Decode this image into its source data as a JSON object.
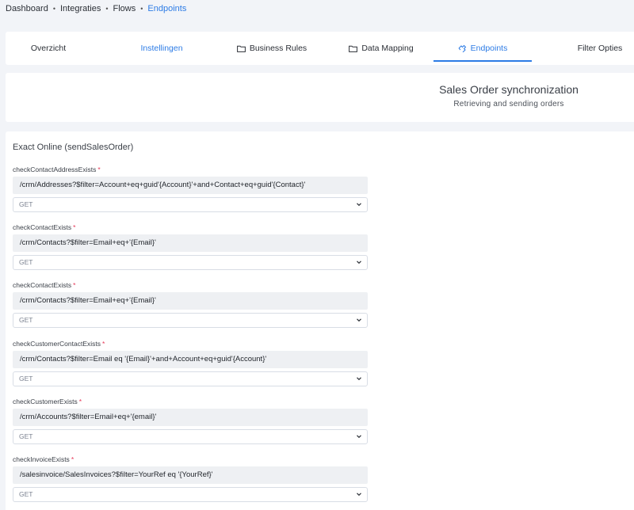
{
  "breadcrumb": {
    "items": [
      "Dashboard",
      "Integraties",
      "Flows",
      "Endpoints"
    ],
    "separator": "•"
  },
  "tabs": [
    {
      "label": "Overzicht",
      "icon": "none"
    },
    {
      "label": "Instellingen",
      "icon": "none"
    },
    {
      "label": "Business Rules",
      "icon": "folder-icon"
    },
    {
      "label": "Data Mapping",
      "icon": "folder-icon"
    },
    {
      "label": "Endpoints",
      "icon": "puzzle-icon"
    },
    {
      "label": "Filter Opties",
      "icon": "none"
    }
  ],
  "hero": {
    "title": "Sales Order synchronization",
    "subtitle": "Retrieving and sending orders"
  },
  "section": {
    "title": "Exact Online (sendSalesOrder)"
  },
  "endpoints": [
    {
      "label": "checkContactAddressExists",
      "required": "*",
      "url": "/crm/Addresses?$filter=Account+eq+guid'{Account}'+and+Contact+eq+guid'{Contact}'",
      "method": "GET"
    },
    {
      "label": "checkContactExists",
      "required": "*",
      "url": "/crm/Contacts?$filter=Email+eq+'{Email}'",
      "method": "GET"
    },
    {
      "label": "checkContactExists",
      "required": "*",
      "url": "/crm/Contacts?$filter=Email+eq+'{Email}'",
      "method": "GET"
    },
    {
      "label": "checkCustomerContactExists",
      "required": "*",
      "url": "/crm/Contacts?$filter=Email eq '{Email}'+and+Account+eq+guid'{Account}'",
      "method": "GET"
    },
    {
      "label": "checkCustomerExists",
      "required": "*",
      "url": "/crm/Accounts?$filter=Email+eq+'{email}'",
      "method": "GET"
    },
    {
      "label": "checkInvoiceExists",
      "required": "*",
      "url": "/salesinvoice/SalesInvoices?$filter=YourRef eq '{YourRef}'",
      "method": "GET"
    }
  ],
  "colors": {
    "accent": "#2c7be5",
    "required": "#e63757",
    "background": "#f2f4f8"
  }
}
